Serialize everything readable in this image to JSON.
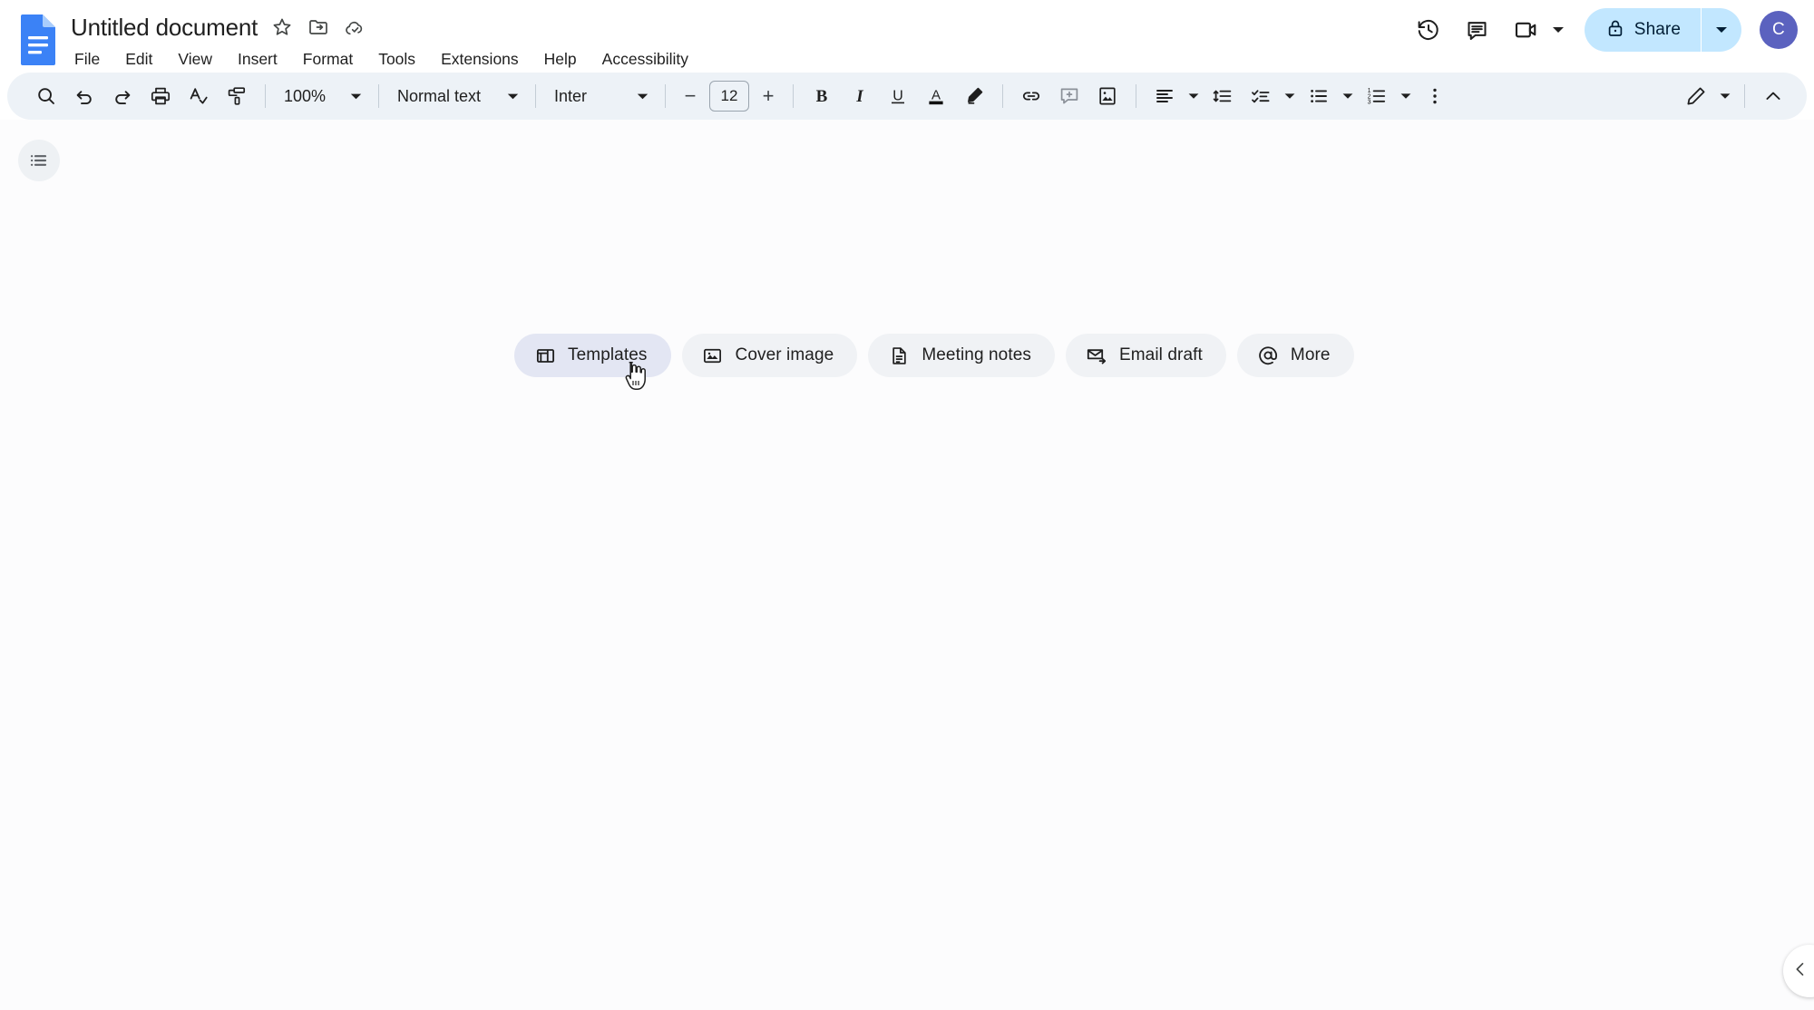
{
  "app": {
    "name": "Google Docs",
    "logo_icon": "docs-file-icon",
    "accent_share_bg": "#c2e7ff",
    "avatar_bg": "#5b62bf",
    "toolbar_bg": "#edf2f7",
    "canvas_bg": "#fcfcfd"
  },
  "header": {
    "doc_title": "Untitled document",
    "title_icons": [
      {
        "name": "star-icon",
        "tooltip": "Star"
      },
      {
        "name": "move-to-folder-icon",
        "tooltip": "Move"
      },
      {
        "name": "cloud-saved-icon",
        "tooltip": "See document status"
      }
    ],
    "menus": [
      {
        "label": "File"
      },
      {
        "label": "Edit"
      },
      {
        "label": "View"
      },
      {
        "label": "Insert"
      },
      {
        "label": "Format"
      },
      {
        "label": "Tools"
      },
      {
        "label": "Extensions"
      },
      {
        "label": "Help"
      },
      {
        "label": "Accessibility"
      }
    ],
    "right_actions": [
      {
        "name": "version-history-icon",
        "label": "Last edit"
      },
      {
        "name": "comment-icon",
        "label": "Open comment history"
      },
      {
        "name": "meet-camera-icon",
        "label": "Join or start a meeting"
      }
    ],
    "share": {
      "label": "Share",
      "lock_icon": "lock-icon",
      "caret_icon": "chevron-down-icon"
    },
    "avatar": {
      "initial": "C"
    }
  },
  "toolbar": {
    "left_items": [
      {
        "name": "search-icon",
        "label": "Search the menus"
      },
      {
        "name": "undo-icon",
        "label": "Undo"
      },
      {
        "name": "redo-icon",
        "label": "Redo"
      },
      {
        "name": "print-icon",
        "label": "Print"
      },
      {
        "name": "spellcheck-icon",
        "label": "Spelling and grammar check"
      },
      {
        "name": "paint-format-icon",
        "label": "Paint format"
      }
    ],
    "zoom": {
      "value": "100%",
      "caret": "chevron-down-icon"
    },
    "paragraph_style": {
      "value": "Normal text",
      "caret": "chevron-down-icon"
    },
    "font": {
      "value": "Inter",
      "caret": "chevron-down-icon"
    },
    "font_size": {
      "value": "12",
      "decrease": "−",
      "increase": "+"
    },
    "format_items": [
      {
        "name": "bold-icon",
        "glyph": "B",
        "label": "Bold"
      },
      {
        "name": "italic-icon",
        "glyph": "I",
        "label": "Italic"
      },
      {
        "name": "underline-icon",
        "glyph": "U",
        "label": "Underline"
      },
      {
        "name": "text-color-icon",
        "glyph": "A",
        "label": "Text color"
      },
      {
        "name": "highlight-color-icon",
        "label": "Highlight color"
      }
    ],
    "insert_items": [
      {
        "name": "insert-link-icon",
        "label": "Insert link"
      },
      {
        "name": "add-comment-icon",
        "label": "Add comment"
      },
      {
        "name": "insert-image-icon",
        "label": "Insert image"
      }
    ],
    "paragraph_items": [
      {
        "name": "align-left-icon",
        "label": "Align"
      },
      {
        "name": "line-spacing-icon",
        "label": "Line & paragraph spacing"
      },
      {
        "name": "checklist-icon",
        "label": "Checklist"
      },
      {
        "name": "bulleted-list-icon",
        "label": "Bulleted list"
      },
      {
        "name": "numbered-list-icon",
        "label": "Numbered list"
      },
      {
        "name": "more-options-icon",
        "label": "More options"
      }
    ],
    "right_items": [
      {
        "name": "editing-mode-pencil-icon",
        "label": "Editing mode"
      },
      {
        "name": "collapse-toolbar-chevron-icon",
        "label": "Hide the menus"
      }
    ]
  },
  "canvas": {
    "outline_toggle": {
      "name": "show-outline-icon",
      "label": "Show document outline"
    },
    "chips": [
      {
        "icon": "templates-icon",
        "label": "Templates",
        "active": true
      },
      {
        "icon": "cover-image-icon",
        "label": "Cover image",
        "active": false
      },
      {
        "icon": "meeting-notes-icon",
        "label": "Meeting notes",
        "active": false
      },
      {
        "icon": "email-draft-icon",
        "label": "Email draft",
        "active": false
      },
      {
        "icon": "at-mention-icon",
        "label": "More",
        "active": false
      }
    ],
    "bottom_toggle": {
      "name": "expand-side-panel-chevron-icon",
      "label": "Open side panel"
    },
    "document_body_text": ""
  }
}
